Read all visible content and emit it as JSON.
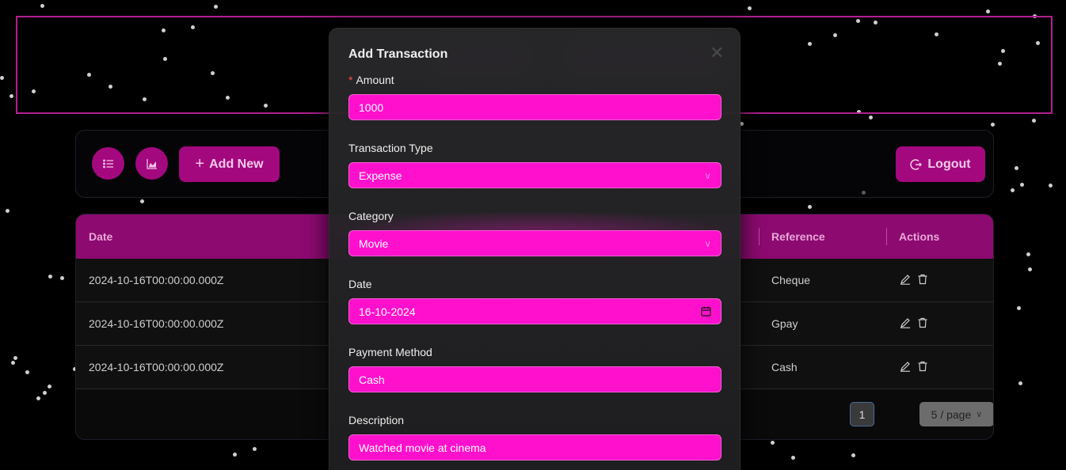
{
  "toolbar": {
    "add_new_label": "Add New",
    "logout_label": "Logout",
    "list_icon": "list-icon",
    "chart_icon": "area-chart-icon"
  },
  "table": {
    "columns": {
      "date": "Date",
      "reference": "Reference",
      "actions": "Actions"
    },
    "rows": [
      {
        "date": "2024-10-16T00:00:00.000Z",
        "reference": "Cheque"
      },
      {
        "date": "2024-10-16T00:00:00.000Z",
        "reference": "Gpay"
      },
      {
        "date": "2024-10-16T00:00:00.000Z",
        "reference": "Cash"
      }
    ],
    "pagination": {
      "current_page": "1",
      "page_size": "5 / page"
    }
  },
  "modal": {
    "title": "Add Transaction",
    "close_icon": "close-icon",
    "fields": {
      "amount": {
        "label": "Amount",
        "required_mark": "*",
        "value": "1000"
      },
      "type": {
        "label": "Transaction Type",
        "value": "Expense"
      },
      "category": {
        "label": "Category",
        "value": "Movie"
      },
      "date": {
        "label": "Date",
        "value": "16-10-2024"
      },
      "payment": {
        "label": "Payment Method",
        "value": "Cash"
      },
      "description": {
        "label": "Description",
        "value": "Watched movie at cinema"
      }
    }
  },
  "colors": {
    "accent": "#a3087e",
    "field_bg": "#ff10cc",
    "header_border": "#b0208f",
    "table_header": "#8d0a70"
  }
}
